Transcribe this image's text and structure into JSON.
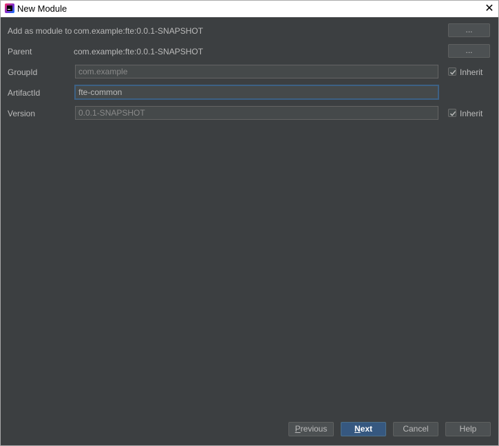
{
  "window": {
    "title": "New Module",
    "close_glyph": "✕"
  },
  "form": {
    "add_as_module": {
      "label": "Add as module to",
      "value": "com.example:fte:0.0.1-SNAPSHOT",
      "button_label": "..."
    },
    "parent": {
      "label": "Parent",
      "value": "com.example:fte:0.0.1-SNAPSHOT",
      "button_label": "..."
    },
    "group_id": {
      "label": "GroupId",
      "value": "com.example",
      "inherit_label": "Inherit",
      "inherit_checked": true
    },
    "artifact_id": {
      "label": "ArtifactId",
      "value": "fte-common"
    },
    "version": {
      "label": "Version",
      "value": "0.0.1-SNAPSHOT",
      "inherit_label": "Inherit",
      "inherit_checked": true
    }
  },
  "buttons": {
    "previous": {
      "mnemonic": "P",
      "rest": "revious"
    },
    "next": {
      "mnemonic": "N",
      "rest": "ext"
    },
    "cancel": "Cancel",
    "help": "Help"
  },
  "colors": {
    "background": "#3c3f41",
    "text": "#bbbbbb",
    "primary_button": "#365880",
    "focus_border": "#3d6185"
  }
}
